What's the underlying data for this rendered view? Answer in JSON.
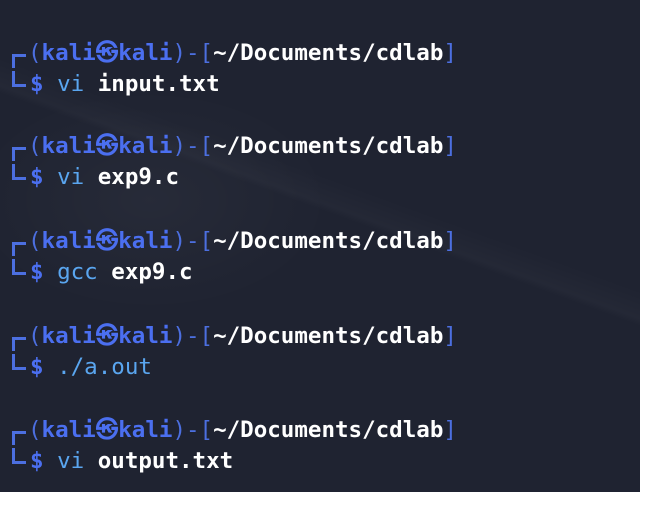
{
  "prompts": [
    {
      "user": "kali",
      "host": "kali",
      "path": "~/Documents/cdlab",
      "cmd": "vi",
      "arg": "input.txt"
    },
    {
      "user": "kali",
      "host": "kali",
      "path": "~/Documents/cdlab",
      "cmd": "vi",
      "arg": "exp9.c"
    },
    {
      "user": "kali",
      "host": "kali",
      "path": "~/Documents/cdlab",
      "cmd": "gcc",
      "arg": "exp9.c"
    },
    {
      "user": "kali",
      "host": "kali",
      "path": "~/Documents/cdlab",
      "cmd": "./a.out",
      "arg": ""
    },
    {
      "user": "kali",
      "host": "kali",
      "path": "~/Documents/cdlab",
      "cmd": "vi",
      "arg": "output.txt"
    }
  ],
  "symbols": {
    "at": "㉿",
    "dollar": "$",
    "open_paren": "(",
    "close_paren": ")",
    "dash": "-",
    "open_bracket": "[",
    "close_bracket": "]"
  },
  "colors": {
    "background": "#1f2331",
    "prompt_blue": "#4b6ff0",
    "command_blue": "#5aa6f0",
    "path_white": "#ffffff"
  }
}
